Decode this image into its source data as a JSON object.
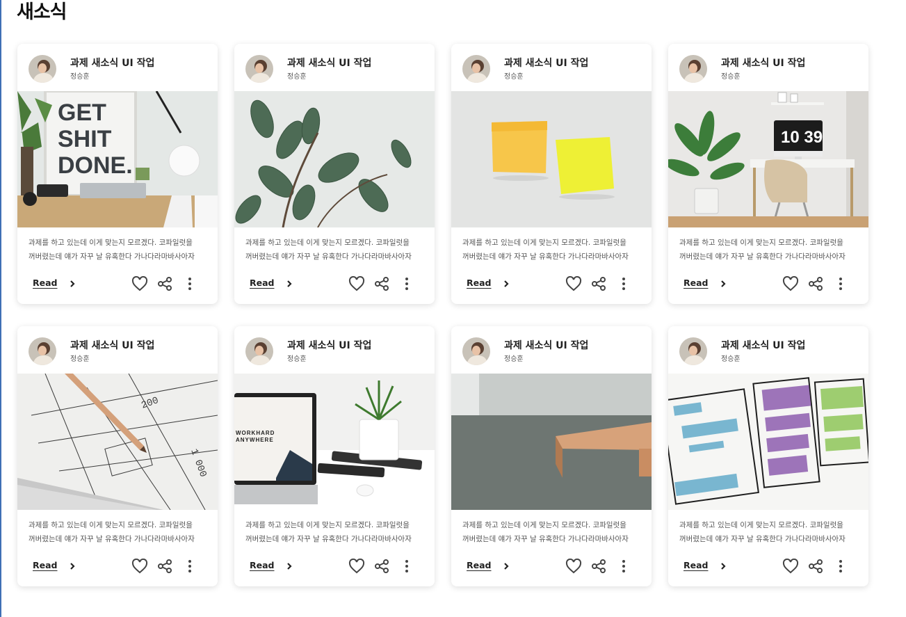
{
  "page": {
    "title": "새소식"
  },
  "colors": {
    "accent_edge": "#3f6fb5",
    "card_bg": "#ffffff",
    "text_muted": "#555555"
  },
  "icons": {
    "like": "heart-icon",
    "share": "share-icon",
    "more": "more-vert-icon",
    "read_arrow": "chevron-right-icon"
  },
  "cards": [
    {
      "title": "과제 새소식 UI 작업",
      "author": "정승훈",
      "desc_line1": "과제를 하고 있는데 이게 맞는지 모르겠다. 코파일럿을",
      "desc_line2": "꺼버렸는데 얘가 자꾸 날 유혹한다 가나다라마바사아자",
      "read_label": "Read",
      "image": "desk-get-shit-done"
    },
    {
      "title": "과제 새소식 UI 작업",
      "author": "정승훈",
      "desc_line1": "과제를 하고 있는데 이게 맞는지 모르겠다. 코파일럿을",
      "desc_line2": "꺼버렸는데 얘가 자꾸 날 유혹한다 가나다라마바사아자",
      "read_label": "Read",
      "image": "rubber-plant"
    },
    {
      "title": "과제 새소식 UI 작업",
      "author": "정승훈",
      "desc_line1": "과제를 하고 있는데 이게 맞는지 모르겠다. 코파일럿을",
      "desc_line2": "꺼버렸는데 얘가 자꾸 날 유혹한다 가나다라마바사아자",
      "read_label": "Read",
      "image": "sticky-notes"
    },
    {
      "title": "과제 새소식 UI 작업",
      "author": "정승훈",
      "desc_line1": "과제를 하고 있는데 이게 맞는지 모르겠다. 코파일럿을",
      "desc_line2": "꺼버렸는데 얘가 자꾸 날 유혹한다 가나다라마바사아자",
      "read_label": "Read",
      "image": "home-office-desk"
    },
    {
      "title": "과제 새소식 UI 작업",
      "author": "정승훈",
      "desc_line1": "과제를 하고 있는데 이게 맞는지 모르겠다. 코파일럿을",
      "desc_line2": "꺼버렸는데 얘가 자꾸 날 유혹한다 가나다라마바사아자",
      "read_label": "Read",
      "image": "blueprint-pencil"
    },
    {
      "title": "과제 새소식 UI 작업",
      "author": "정승훈",
      "desc_line1": "과제를 하고 있는데 이게 맞는지 모르겠다. 코파일럿을",
      "desc_line2": "꺼버렸는데 얘가 자꾸 날 유혹한다 가나다라마바사아자",
      "read_label": "Read",
      "image": "laptop-workhard-anywhere"
    },
    {
      "title": "과제 새소식 UI 작업",
      "author": "정승훈",
      "desc_line1": "과제를 하고 있는데 이게 맞는지 모르겠다. 코파일럿을",
      "desc_line2": "꺼버렸는데 얘가 자꾸 날 유혹한다 가나다라마바사아자",
      "read_label": "Read",
      "image": "wooden-bench-floor"
    },
    {
      "title": "과제 새소식 UI 작업",
      "author": "정승훈",
      "desc_line1": "과제를 하고 있는데 이게 맞는지 모르겠다. 코파일럿을",
      "desc_line2": "꺼버렸는데 얘가 자꾸 날 유혹한다 가나다라마바사아자",
      "read_label": "Read",
      "image": "wireframe-sketch"
    }
  ],
  "image_texts": {
    "poster_line1": "GET",
    "poster_line2": "SHIT",
    "poster_line3": "DONE.",
    "clock": "10 39",
    "laptop_line1": "WORKHARD",
    "laptop_line2": "ANYWHERE"
  }
}
